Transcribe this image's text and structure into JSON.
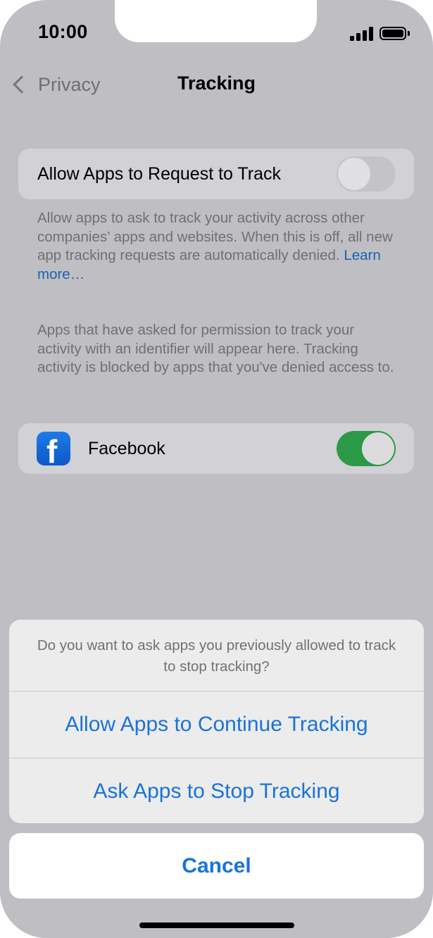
{
  "status_bar": {
    "time": "10:00",
    "signal_icon": "cellular-signal-icon",
    "battery_icon": "battery-full-icon"
  },
  "nav": {
    "back_label": "Privacy",
    "back_icon": "chevron-left-icon",
    "title": "Tracking"
  },
  "allow_section": {
    "row_label": "Allow Apps to Request to Track",
    "toggle_on": false,
    "footer_text": "Allow apps to ask to track your activity across other companies’ apps and websites. When this is off, all new app tracking requests are automatically denied.",
    "learn_more": "Learn more…"
  },
  "apps_section": {
    "header_text": "Apps that have asked for permission to track your activity with an identifier will appear here. Tracking activity is blocked by apps that you've denied access to.",
    "apps": [
      {
        "name": "Facebook",
        "icon": "facebook-app-icon",
        "icon_glyph": "f",
        "toggle_on": true
      }
    ]
  },
  "action_sheet": {
    "message": "Do you want to ask apps you previously allowed to track to stop tracking?",
    "actions": [
      {
        "label": "Allow Apps to Continue Tracking"
      },
      {
        "label": "Ask Apps to Stop Tracking"
      }
    ],
    "cancel_label": "Cancel"
  },
  "colors": {
    "accent": "#1a73d9",
    "link": "#1a62b3",
    "toggle_on": "#2b9a46",
    "dimmed_background": "#bebec3"
  }
}
